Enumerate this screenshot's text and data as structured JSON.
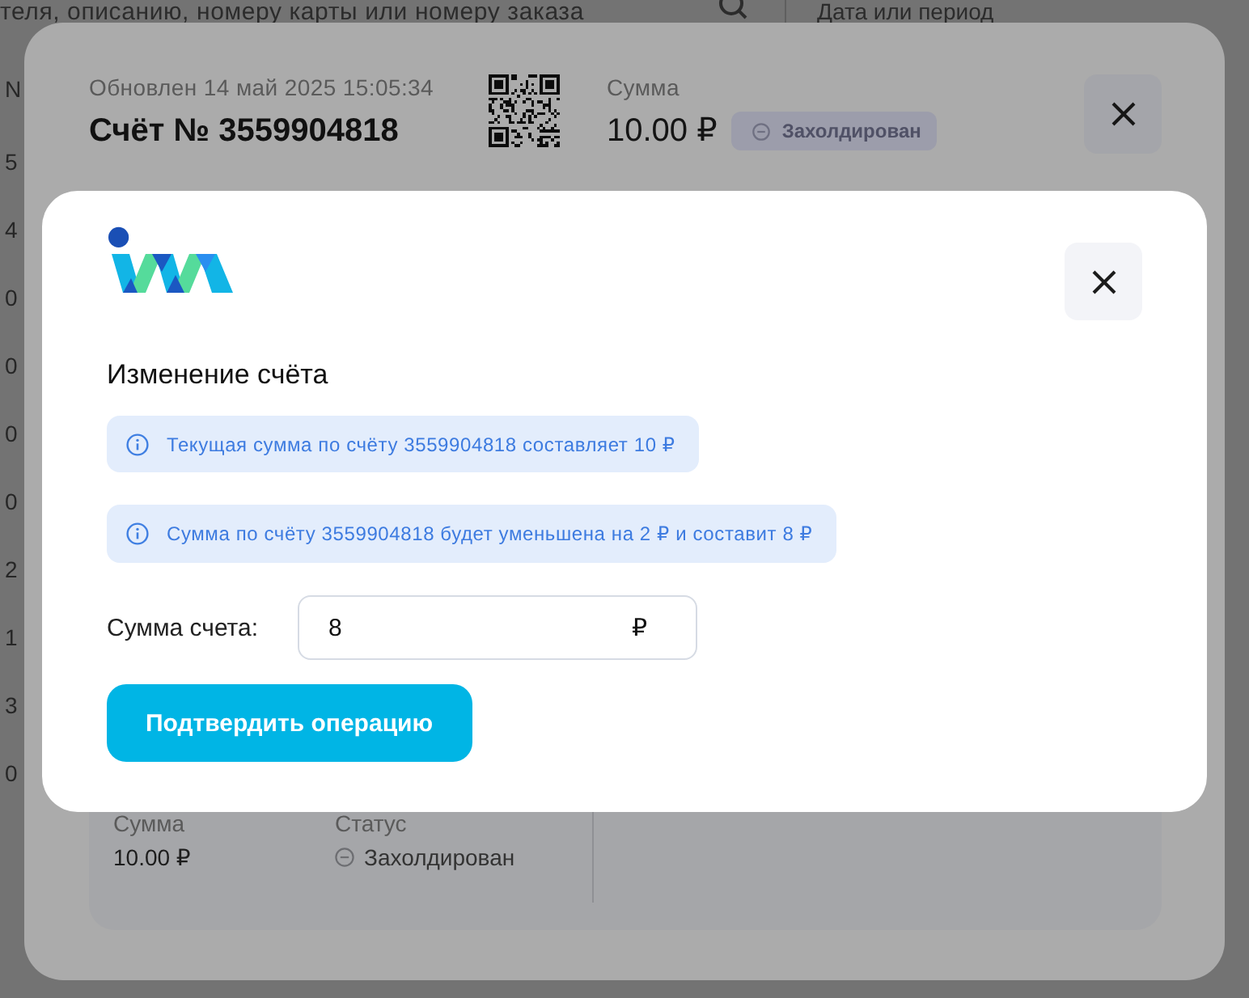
{
  "background": {
    "search_bar": {
      "placeholder": "теля, описанию, номеру карты или номеру заказа"
    },
    "date_filter": {
      "placeholder": "Дата или период"
    },
    "table": {
      "header": "N",
      "rows": [
        "5",
        "4",
        "0",
        "0",
        "0",
        "0",
        "2",
        "1",
        "3",
        "0"
      ]
    }
  },
  "invoice_panel": {
    "updated": "Обновлен 14 май 2025 15:05:34",
    "title": "Счёт № 3559904818",
    "amount_label": "Сумма",
    "amount": "10.00 ₽",
    "status": {
      "kind": "hold",
      "label": "Захолдирован"
    },
    "details": [
      {
        "kind": "text",
        "label": "Сумма",
        "value": "10.00 ₽"
      },
      {
        "kind": "status",
        "label": "Статус",
        "value": "Захолдирован"
      }
    ]
  },
  "dialog": {
    "title": "Изменение счёта",
    "notices": [
      {
        "kind": "info",
        "text": "Текущая сумма по счёту 3559904818 составляет 10 ₽"
      },
      {
        "kind": "info",
        "text": "Сумма по счёту 3559904818 будет уменьшена на 2 ₽ и составит 8 ₽"
      }
    ],
    "amount_field": {
      "label": "Сумма счета:",
      "value": "8",
      "suffix": "₽"
    },
    "confirm_button": "Подтвердить операцию"
  }
}
